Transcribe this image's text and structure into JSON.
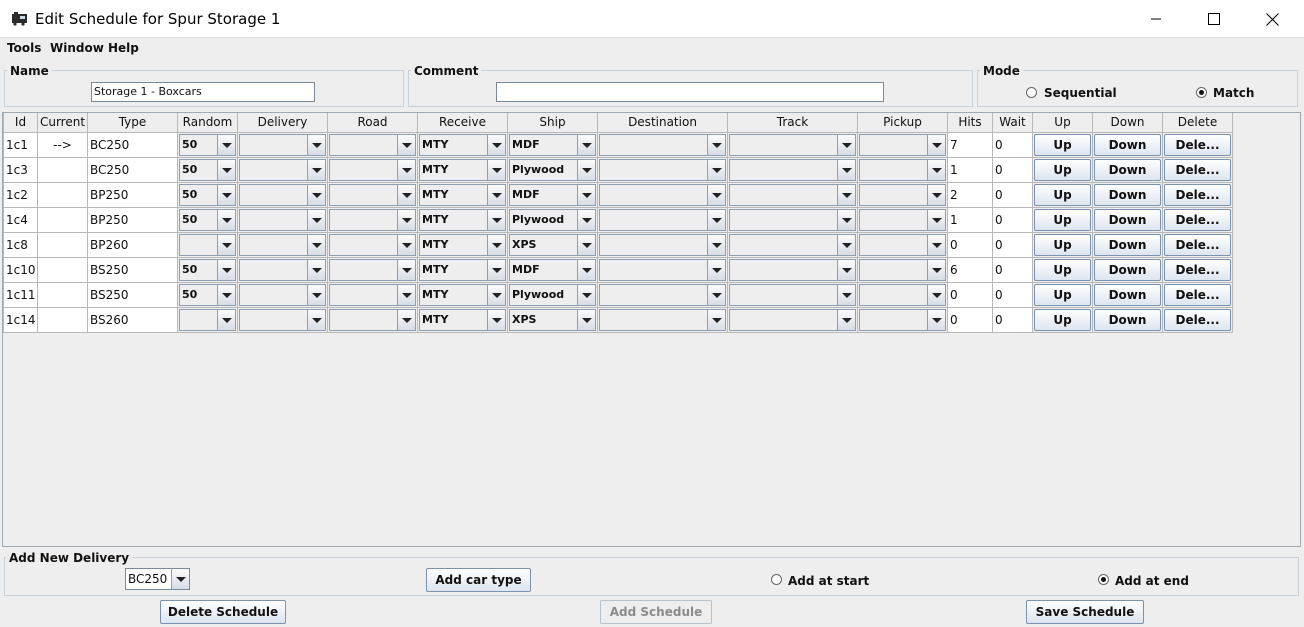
{
  "window": {
    "title": "Edit Schedule for Spur Storage 1",
    "icon": "train-icon",
    "controls": [
      "minimize-icon",
      "maximize-icon",
      "close-icon"
    ]
  },
  "menu": [
    "Tools",
    "Window",
    "Help"
  ],
  "name_group": {
    "title": "Name",
    "value": "Storage 1 - Boxcars"
  },
  "comment_group": {
    "title": "Comment",
    "value": ""
  },
  "mode_group": {
    "title": "Mode",
    "options": [
      {
        "label": "Sequential",
        "selected": false
      },
      {
        "label": "Match",
        "selected": true
      }
    ]
  },
  "table": {
    "columns": [
      "Id",
      "Current",
      "Type",
      "Random",
      "Delivery",
      "Road",
      "Receive",
      "Ship",
      "Destination",
      "Track",
      "Pickup",
      "Hits",
      "Wait",
      "Up",
      "Down",
      "Delete"
    ],
    "rows": [
      {
        "id": "1c1",
        "current": "-->",
        "type": "BC250",
        "random": "50",
        "delivery": "",
        "road": "",
        "receive": "MTY",
        "ship": "MDF",
        "destination": "",
        "track": "",
        "pickup": "",
        "hits": "7",
        "wait": "0",
        "up": "Up",
        "down": "Down",
        "delete": "Dele..."
      },
      {
        "id": "1c3",
        "current": "",
        "type": "BC250",
        "random": "50",
        "delivery": "",
        "road": "",
        "receive": "MTY",
        "ship": "Plywood",
        "destination": "",
        "track": "",
        "pickup": "",
        "hits": "1",
        "wait": "0",
        "up": "Up",
        "down": "Down",
        "delete": "Dele..."
      },
      {
        "id": "1c2",
        "current": "",
        "type": "BP250",
        "random": "50",
        "delivery": "",
        "road": "",
        "receive": "MTY",
        "ship": "MDF",
        "destination": "",
        "track": "",
        "pickup": "",
        "hits": "2",
        "wait": "0",
        "up": "Up",
        "down": "Down",
        "delete": "Dele..."
      },
      {
        "id": "1c4",
        "current": "",
        "type": "BP250",
        "random": "50",
        "delivery": "",
        "road": "",
        "receive": "MTY",
        "ship": "Plywood",
        "destination": "",
        "track": "",
        "pickup": "",
        "hits": "1",
        "wait": "0",
        "up": "Up",
        "down": "Down",
        "delete": "Dele..."
      },
      {
        "id": "1c8",
        "current": "",
        "type": "BP260",
        "random": "",
        "delivery": "",
        "road": "",
        "receive": "MTY",
        "ship": "XPS",
        "destination": "",
        "track": "",
        "pickup": "",
        "hits": "0",
        "wait": "0",
        "up": "Up",
        "down": "Down",
        "delete": "Dele..."
      },
      {
        "id": "1c10",
        "current": "",
        "type": "BS250",
        "random": "50",
        "delivery": "",
        "road": "",
        "receive": "MTY",
        "ship": "MDF",
        "destination": "",
        "track": "",
        "pickup": "",
        "hits": "6",
        "wait": "0",
        "up": "Up",
        "down": "Down",
        "delete": "Dele..."
      },
      {
        "id": "1c11",
        "current": "",
        "type": "BS250",
        "random": "50",
        "delivery": "",
        "road": "",
        "receive": "MTY",
        "ship": "Plywood",
        "destination": "",
        "track": "",
        "pickup": "",
        "hits": "0",
        "wait": "0",
        "up": "Up",
        "down": "Down",
        "delete": "Dele..."
      },
      {
        "id": "1c14",
        "current": "",
        "type": "BS260",
        "random": "",
        "delivery": "",
        "road": "",
        "receive": "MTY",
        "ship": "XPS",
        "destination": "",
        "track": "",
        "pickup": "",
        "hits": "0",
        "wait": "0",
        "up": "Up",
        "down": "Down",
        "delete": "Dele..."
      }
    ]
  },
  "add_delivery": {
    "title": "Add New Delivery",
    "car_type": "BC250",
    "add_car_type_label": "Add car type",
    "options": [
      {
        "label": "Add at start",
        "selected": false
      },
      {
        "label": "Add at end",
        "selected": true
      }
    ]
  },
  "footer": {
    "delete_label": "Delete Schedule",
    "add_label": "Add Schedule",
    "add_enabled": false,
    "save_label": "Save Schedule"
  }
}
